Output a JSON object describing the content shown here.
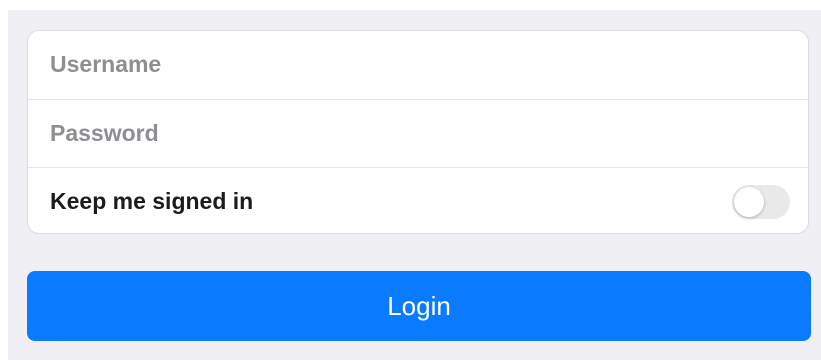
{
  "form": {
    "username": {
      "placeholder": "Username",
      "value": ""
    },
    "password": {
      "placeholder": "Password",
      "value": ""
    },
    "keep_signed_in": {
      "label": "Keep me signed in",
      "checked": false
    }
  },
  "login_button": {
    "label": "Login"
  },
  "colors": {
    "background": "#f0eff4",
    "accent": "#0a7aff",
    "placeholder": "#8e8e93",
    "toggle_off": "#e9e9ea"
  }
}
